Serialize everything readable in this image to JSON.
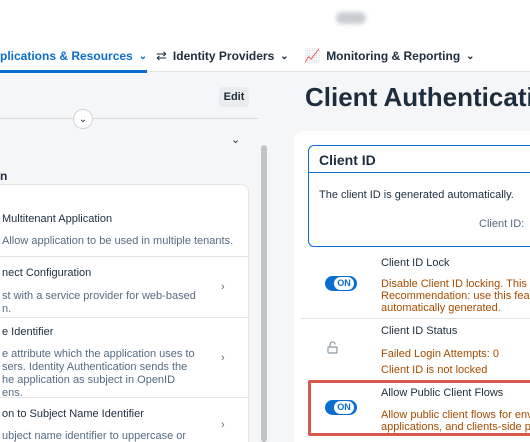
{
  "nav": {
    "tabs": [
      {
        "label": "plications & Resources",
        "active": true
      },
      {
        "label": "Identity Providers",
        "active": false
      },
      {
        "label": "Monitoring & Reporting",
        "active": false
      }
    ]
  },
  "left": {
    "edit_label": "Edit",
    "section_title": "n",
    "items": [
      {
        "title": "Multitenant Application",
        "desc": "Allow application to be used in multiple tenants."
      },
      {
        "title": "nect Configuration",
        "desc": "st with a service provider for web-based\nn."
      },
      {
        "title": "e Identifier",
        "desc": "e attribute which the application uses to\nsers. Identity Authentication sends the\nhe application as subject in OpenID\nens."
      },
      {
        "title": "on to Subject Name Identifier",
        "desc": "ubject name identifier to uppercase or"
      }
    ]
  },
  "right": {
    "page_title": "Client Authenticati",
    "client_id": {
      "title": "Client ID",
      "text": "The client ID is generated automatically.",
      "label": "Client ID:"
    },
    "settings": [
      {
        "title": "Client ID Lock",
        "toggle": "ON",
        "desc": "Disable Client ID locking. This op\nRecommendation: use this featu\nautomatically generated."
      },
      {
        "title": "Client ID Status",
        "desc": "Failed Login Attempts: 0\nClient ID is not locked"
      },
      {
        "title": "Allow Public Client Flows",
        "toggle": "ON",
        "desc": "Allow public client flows for envi\napplications, and clients-side pa"
      }
    ]
  },
  "colors": {
    "accent": "#0a6ed1",
    "highlight": "#d9574a",
    "warning_text": "#a34d00"
  }
}
